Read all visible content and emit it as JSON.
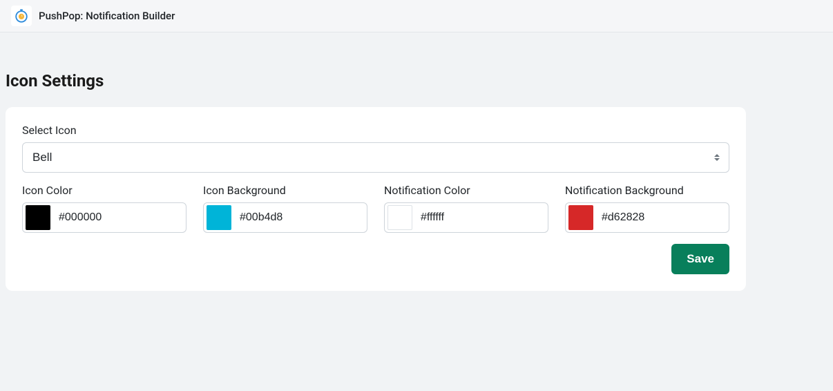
{
  "header": {
    "app_title": "PushPop: Notification Builder"
  },
  "page": {
    "title": "Icon Settings"
  },
  "form": {
    "select_icon": {
      "label": "Select Icon",
      "value": "Bell",
      "options": [
        "Bell"
      ]
    },
    "icon_color": {
      "label": "Icon Color",
      "value": "#000000",
      "swatch": "#000000"
    },
    "icon_background": {
      "label": "Icon Background",
      "value": "#00b4d8",
      "swatch": "#00b4d8"
    },
    "notification_color": {
      "label": "Notification Color",
      "value": "#ffffff",
      "swatch": "#ffffff"
    },
    "notification_background": {
      "label": "Notification Background",
      "value": "#d62828",
      "swatch": "#d62828"
    },
    "save_label": "Save"
  },
  "colors": {
    "accent_button_bg": "#087f5b"
  }
}
